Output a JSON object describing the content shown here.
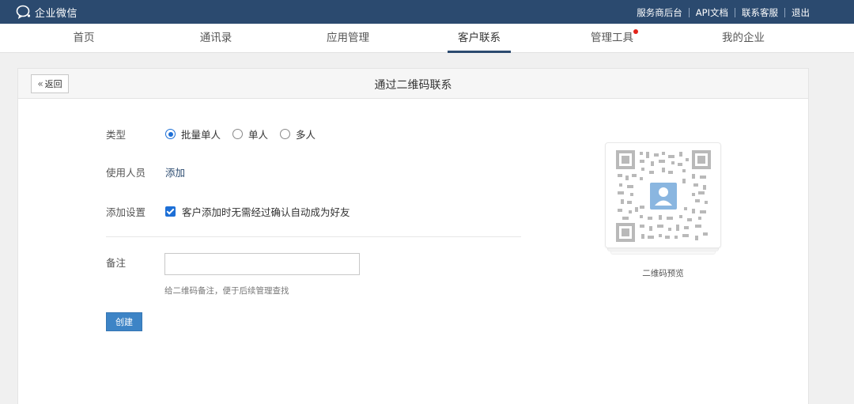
{
  "app": {
    "title": "企业微信",
    "brand_color": "#2b4a6f",
    "accent_color": "#1d6fd6"
  },
  "topbar": {
    "links": [
      "服务商后台",
      "API文档",
      "联系客服",
      "退出"
    ]
  },
  "nav": {
    "items": [
      {
        "label": "首页"
      },
      {
        "label": "通讯录"
      },
      {
        "label": "应用管理"
      },
      {
        "label": "客户联系",
        "active": true
      },
      {
        "label": "管理工具",
        "badge": "red-dot"
      },
      {
        "label": "我的企业"
      }
    ]
  },
  "panel": {
    "back_label": "返回",
    "title": "通过二维码联系"
  },
  "form": {
    "type_label": "类型",
    "type_options": [
      "批量单人",
      "单人",
      "多人"
    ],
    "type_selected": "批量单人",
    "user_label": "使用人员",
    "user_add_link": "添加",
    "setting_label": "添加设置",
    "setting_checkbox": "客户添加时无需经过确认自动成为好友",
    "setting_checked": true,
    "note_label": "备注",
    "note_value": "",
    "note_hint": "给二维码备注，便于后续管理查找",
    "create_label": "创建"
  },
  "preview": {
    "caption": "二维码预览"
  }
}
